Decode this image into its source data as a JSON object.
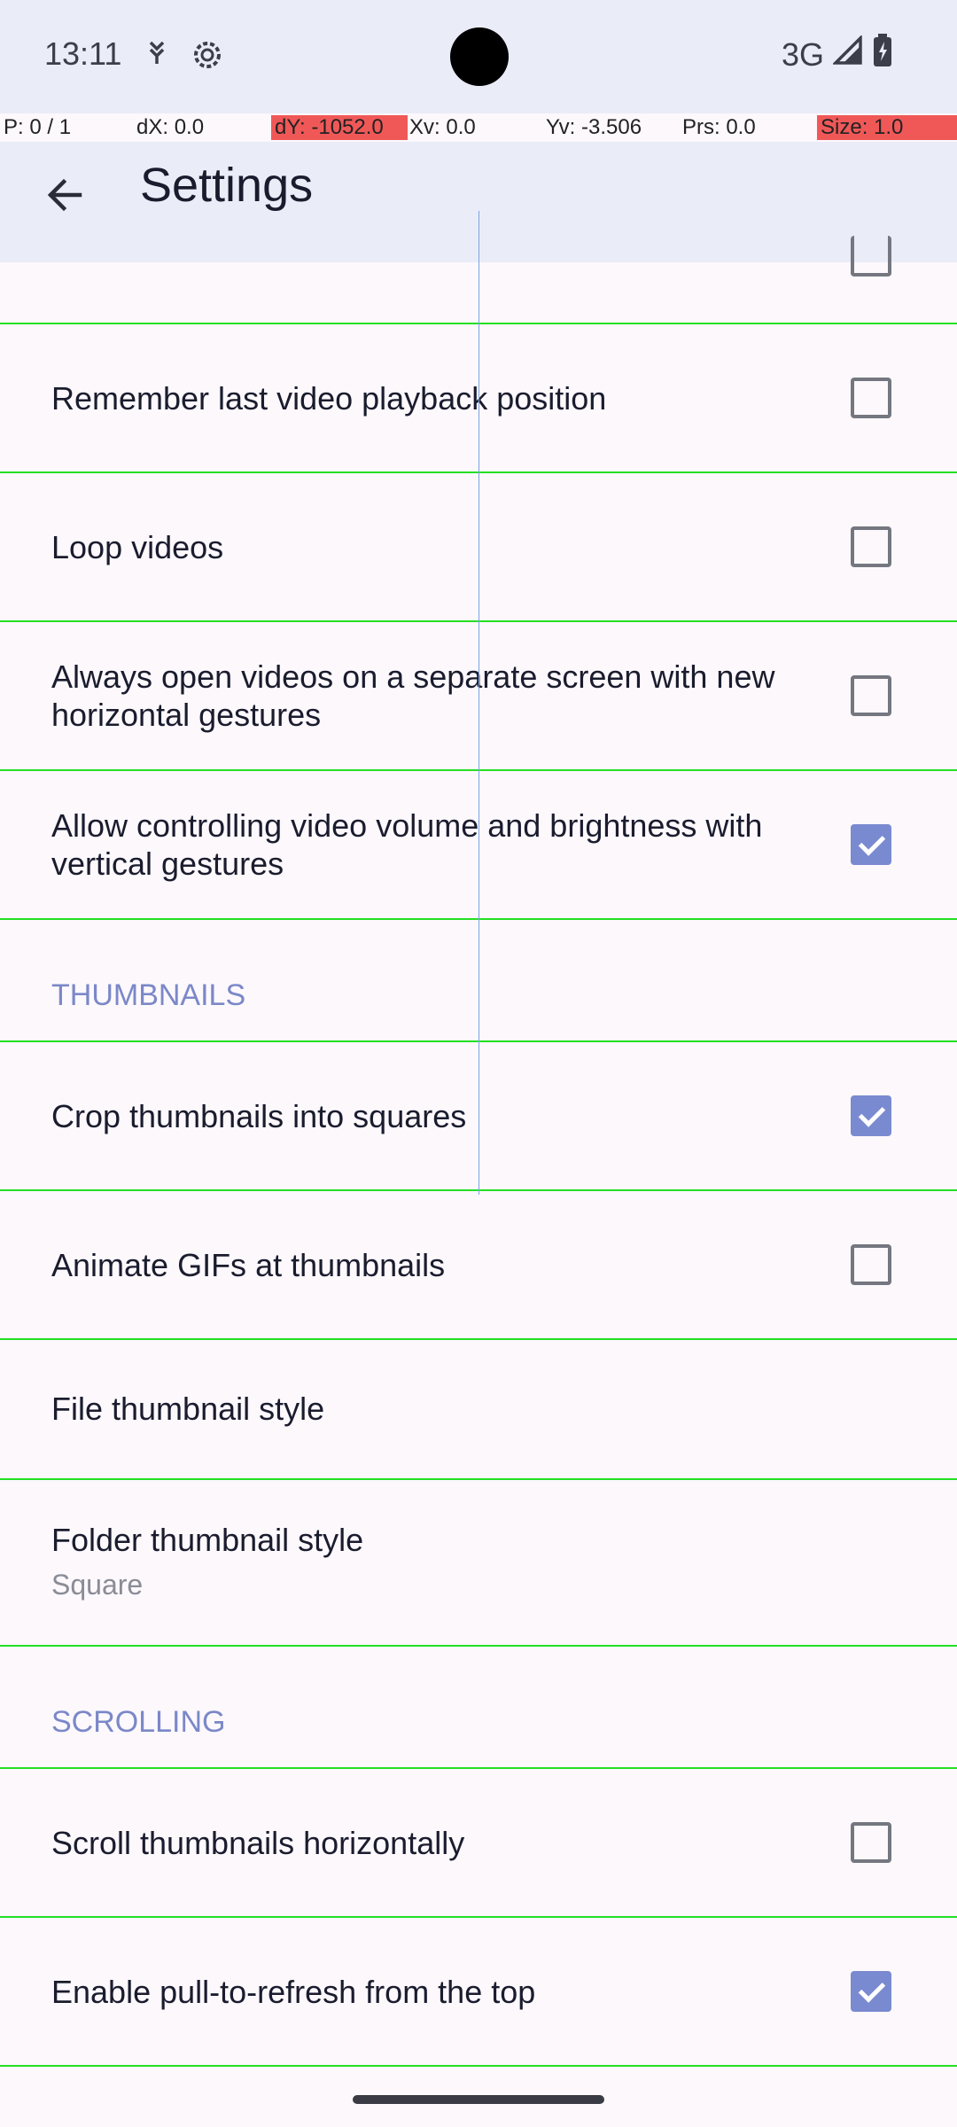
{
  "status_bar": {
    "time": "13:11",
    "network": "3G",
    "icons": [
      "notification-icon",
      "settings-gear-icon",
      "signal-icon",
      "battery-icon"
    ]
  },
  "debug_overlay": {
    "pointer": "P: 0 / 1",
    "dx": "dX: 0.0",
    "dy": "dY: -1052.0",
    "xv": "Xv: 0.0",
    "yv": "Yv: -3.506",
    "prs": "Prs: 0.0",
    "size": "Size: 1.0"
  },
  "toolbar": {
    "title": "Settings",
    "back_icon": "arrow-back-icon"
  },
  "settings": {
    "remember_playback": {
      "label": "Remember last video playback position",
      "checked": false
    },
    "loop_videos": {
      "label": "Loop videos",
      "checked": false
    },
    "separate_screen": {
      "label": "Always open videos on a separate screen with new horizontal gestures",
      "checked": false
    },
    "vertical_gestures": {
      "label": "Allow controlling video volume and brightness with vertical gestures",
      "checked": true
    },
    "thumbnails_header": "THUMBNAILS",
    "crop_thumbnails": {
      "label": "Crop thumbnails into squares",
      "checked": true
    },
    "animate_gifs": {
      "label": "Animate GIFs at thumbnails",
      "checked": false
    },
    "file_thumb_style": {
      "label": "File thumbnail style"
    },
    "folder_thumb_style": {
      "label": "Folder thumbnail style",
      "value": "Square"
    },
    "scrolling_header": "SCROLLING",
    "scroll_horizontal": {
      "label": "Scroll thumbnails horizontally",
      "checked": false
    },
    "pull_to_refresh": {
      "label": "Enable pull-to-refresh from the top",
      "checked": true
    }
  },
  "colors": {
    "accent": "#7a8ad0",
    "header_bg": "#eaedf8",
    "section_text": "#7b88c8"
  }
}
